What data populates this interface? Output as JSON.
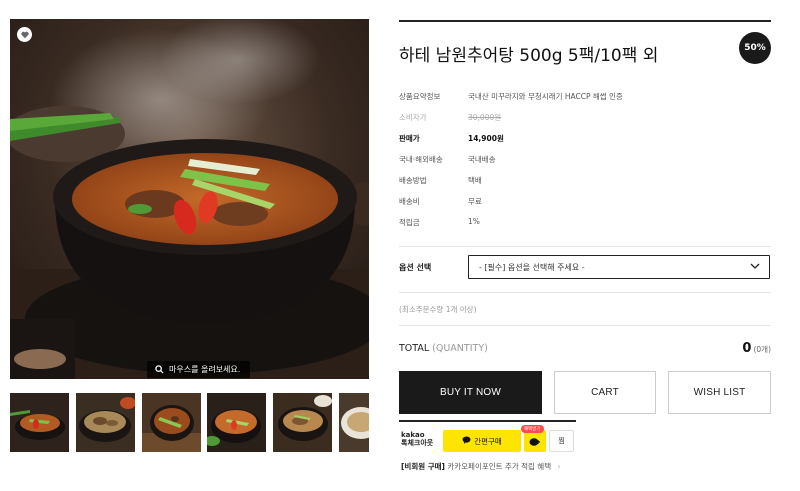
{
  "gallery": {
    "zoom_hint": "마우스를 올려보세요.",
    "thumbnail_count": 6
  },
  "product": {
    "title": "하테 남원추어탕 500g 5팩/10팩 외",
    "discount_badge": "50%",
    "specs": [
      {
        "label": "상품요약정보",
        "value": "국내산 미꾸라지와 무청시래기 HACCP 해썹 인증"
      },
      {
        "label": "소비자가",
        "value": "30,000원"
      },
      {
        "label": "판매가",
        "value": "14,900원"
      },
      {
        "label": "국내·해외배송",
        "value": "국내배송"
      },
      {
        "label": "배송방법",
        "value": "택배"
      },
      {
        "label": "배송비",
        "value": "무료"
      },
      {
        "label": "적립금",
        "value": "1%"
      }
    ]
  },
  "options": {
    "label": "옵션 선택",
    "selected": "- [필수] 옵션을 선택해 주세요 -"
  },
  "min_order": "(최소주문수량 1개 이상)",
  "total": {
    "label": "TOTAL",
    "sub": "(QUANTITY)",
    "value": "0",
    "unit": "(0개)"
  },
  "buttons": {
    "buy": "BUY IT NOW",
    "cart": "CART",
    "wishlist": "WISH LIST"
  },
  "kakao": {
    "logo_line1": "kakao",
    "logo_line2": "톡체크아웃",
    "pay_label": "간편구매",
    "badge": "혜택받기",
    "zzim": "찜",
    "note_tag": "[비회원 구매]",
    "note_text": "카카오페이포인트 추가 적립 혜택"
  },
  "colors": {
    "accent_dark": "#1a1a1a",
    "kakao_yellow": "#fee500",
    "border": "#cccccc"
  }
}
